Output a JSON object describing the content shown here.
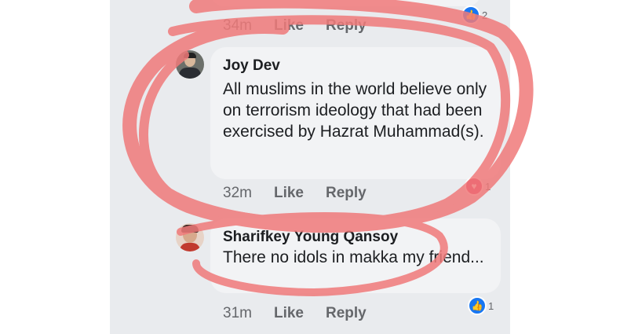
{
  "comments": [
    {
      "time": "34m",
      "like": "Like",
      "reply": "Reply",
      "reaction_count": "2",
      "reaction_icon": "like-icon"
    },
    {
      "author": "Joy Dev",
      "text": "All muslims in the world believe only on terrorism ideology that had been exercised by Hazrat Muhammad(s).",
      "time": "32m",
      "like": "Like",
      "reply": "Reply",
      "reaction_count": "1",
      "reaction_icon": "love-icon"
    },
    {
      "author": "Sharifkey Young Qansoy",
      "text": "There no idols in makka my friend...",
      "time": "31m",
      "like": "Like",
      "reply": "Reply",
      "reaction_count": "1",
      "reaction_icon": "like-icon"
    }
  ],
  "colors": {
    "background": "#e9ebee",
    "bubble": "#f2f3f5",
    "annotation": "#f07a7a",
    "like_blue": "#1877f2",
    "love_red": "#e0245e"
  }
}
